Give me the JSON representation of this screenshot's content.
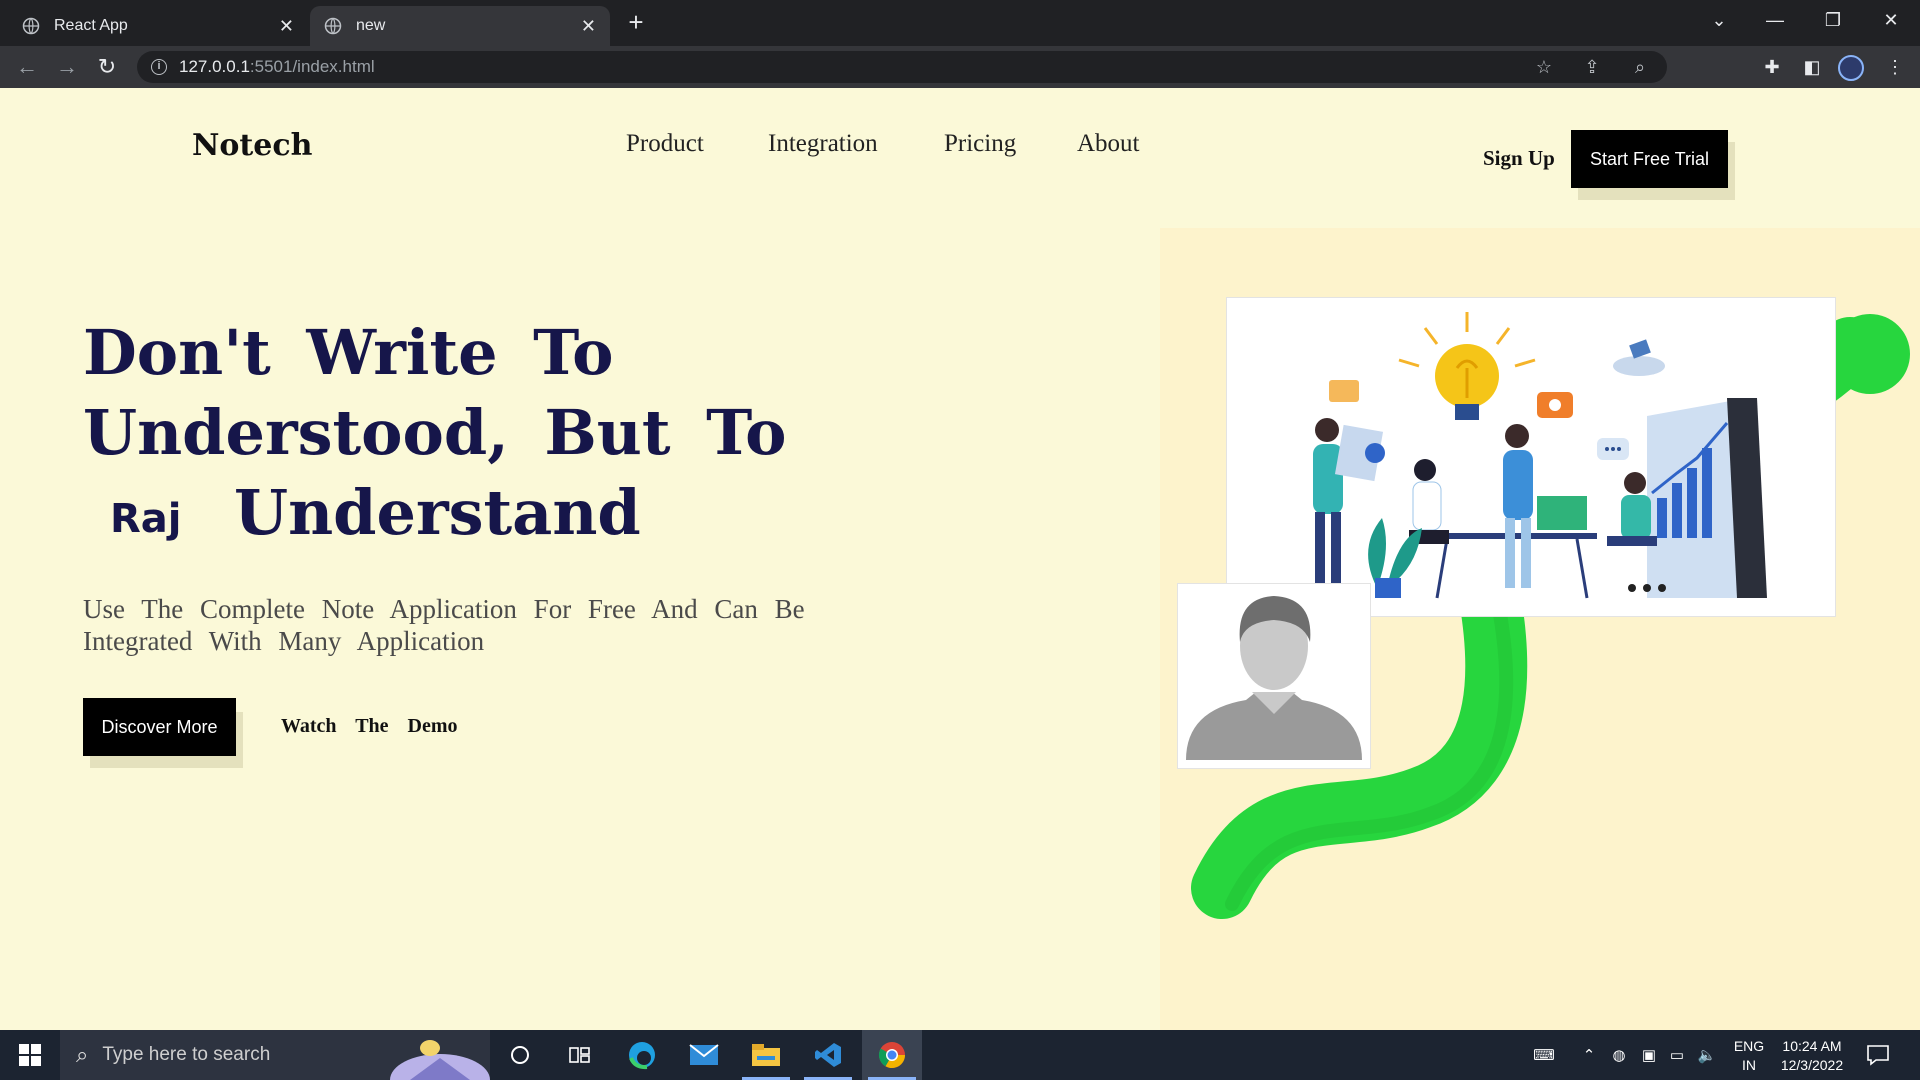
{
  "browser": {
    "tabs": [
      {
        "title": "React App",
        "active": false
      },
      {
        "title": "new",
        "active": true
      }
    ],
    "new_tab": "+",
    "url_host": "127.0.0.1",
    "url_path": ":5501/index.html"
  },
  "nav": {
    "logo": "Notech",
    "links": [
      "Product",
      "Integration",
      "Pricing",
      "About"
    ],
    "signup": "Sign Up",
    "cta": "Start Free Trial"
  },
  "hero": {
    "line1": "Don't Write To",
    "line2": "Understood, But To",
    "line3": "Understand",
    "signature": "Raj",
    "subtitle": "Use The Complete Note Application For Free And Can Be Integrated With Many Application",
    "discover": "Discover More",
    "watch": "Watch The Demo"
  },
  "taskbar": {
    "search_placeholder": "Type here to search",
    "lang_line1": "ENG",
    "lang_line2": "IN",
    "time": "10:24 AM",
    "date": "12/3/2022"
  },
  "colors": {
    "page_bg": "#fbf9d8",
    "heading": "#16164a",
    "accent_green": "#27d63e",
    "button_bg": "#000000"
  }
}
